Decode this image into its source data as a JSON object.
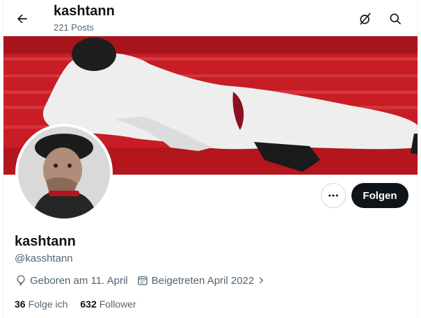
{
  "header": {
    "title": "kashtann",
    "posts_count": "221 Posts"
  },
  "profile": {
    "display_name": "kashtann",
    "handle": "@kasshtann",
    "birthday": "Geboren am 11. April",
    "joined": "Beigetreten April 2022",
    "following_count": "36",
    "following_label": "Folge ich",
    "followers_count": "632",
    "followers_label": "Follower"
  },
  "actions": {
    "follow_label": "Folgen"
  },
  "icons": {
    "back": "arrow-left-icon",
    "grok": "grok-icon",
    "search": "search-icon",
    "more": "more-dots-icon",
    "birthday": "balloon-icon",
    "joined": "calendar-icon",
    "chevron": "chevron-right-icon"
  },
  "colors": {
    "follow_button_bg": "#0f1419",
    "secondary_text": "#536471",
    "banner_red": "#c41a22"
  }
}
